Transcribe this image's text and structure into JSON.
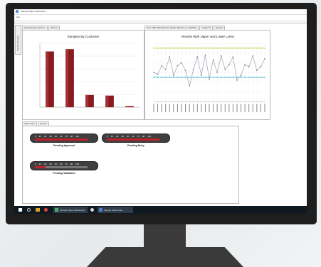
{
  "window": {
    "title": "Sample Status Dashboard",
    "menu": "File"
  },
  "side_tab": "Sample Browser",
  "top_left_tabs": [
    {
      "label": "Samples By Customer"
    },
    {
      "label": "Options"
    }
  ],
  "top_right_tabs": [
    {
      "label": "Test: 6001-0010 Result: Weight (Metric) vs. SAMPLE"
    },
    {
      "label": "Graph Ttl"
    },
    {
      "label": "Options"
    }
  ],
  "bottom_tabs": [
    {
      "label": "Stack View"
    },
    {
      "label": "Options"
    }
  ],
  "chart_data": [
    {
      "type": "bar",
      "title": "Samples By Customer",
      "categories": [
        "",
        "",
        "",
        "",
        ""
      ],
      "values": [
        96,
        100,
        21,
        20,
        2
      ],
      "ylim": [
        0,
        110
      ],
      "colors": [
        "#8b1a1f"
      ],
      "grid": true
    },
    {
      "type": "line",
      "title": "Results With Upper and Lower Limits",
      "x": [
        1,
        2,
        3,
        4,
        5,
        6,
        7,
        8,
        9,
        10,
        11,
        12,
        13,
        14,
        15,
        16,
        17,
        18,
        19,
        20,
        21,
        22,
        23,
        24,
        25,
        26,
        27,
        28,
        29
      ],
      "series": [
        {
          "values": [
            50,
            48,
            57,
            53,
            66,
            47,
            57,
            60,
            52,
            36,
            53,
            66,
            47,
            68,
            43,
            63,
            50,
            67,
            53,
            58,
            66,
            42,
            47,
            58,
            56,
            67,
            52,
            56,
            64
          ]
        }
      ],
      "upper_limit": 75,
      "lower_limit": 45,
      "ylim": [
        20,
        80
      ],
      "grid": true,
      "colors": {
        "series": "#9aa4ad",
        "upper": "#c7cc3a",
        "lower": "#35b8c9"
      }
    }
  ],
  "stacks": [
    {
      "label": "Pending Approval",
      "numbers": [
        "0",
        "13",
        "25",
        "38",
        "50",
        "63",
        "75",
        "88",
        "100"
      ],
      "fill": 1.0
    },
    {
      "label": "Pending Entry",
      "numbers": [
        "0",
        "13",
        "25",
        "38",
        "50",
        "63",
        "75",
        "88",
        "100"
      ],
      "fill": 1.0
    },
    {
      "label": "Pending Validation",
      "numbers": [
        "0",
        "13",
        "25",
        "38",
        "50",
        "63",
        "75",
        "88",
        "100"
      ],
      "fill": 0.2
    }
  ],
  "taskbar": {
    "items": [
      {
        "label": "Sample Status Dashboard"
      },
      {
        "label": "Sample Status Das..."
      }
    ]
  },
  "colors": {
    "bar": "#8b1a1f",
    "pill_fill": "#c0212b",
    "taskbar": "#101820"
  }
}
